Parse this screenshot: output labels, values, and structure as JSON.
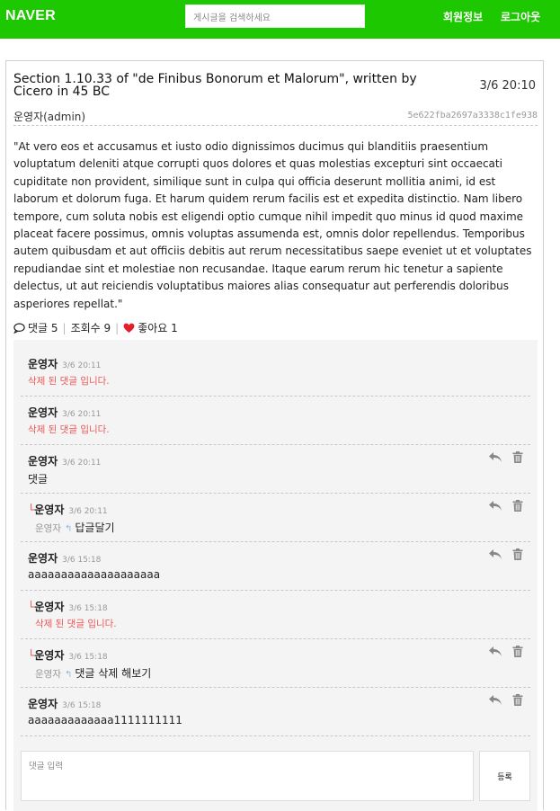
{
  "header": {
    "brand": "NAVER",
    "search_placeholder": "게시글을 검색하세요",
    "nav_info": "회원정보",
    "nav_logout": "로그아웃",
    "colors": {
      "brand_green": "#1ec800",
      "deleted_red": "#ee5555",
      "heart": "#e0202b"
    }
  },
  "post": {
    "title": "Section 1.10.33 of \"de Finibus Bonorum et Malorum\", written by Cicero in 45 BC",
    "date": "3/6 20:10",
    "author": "운영자(admin)",
    "id": "5e622fba2697a3338c1fe938",
    "body": "\"At vero eos et accusamus et iusto odio dignissimos ducimus qui blanditiis praesentium voluptatum deleniti atque corrupti quos dolores et quas molestias excepturi sint occaecati cupiditate non provident, similique sunt in culpa qui officia deserunt mollitia animi, id est laborum et dolorum fuga. Et harum quidem rerum facilis est et expedita distinctio. Nam libero tempore, cum soluta nobis est eligendi optio cumque nihil impedit quo minus id quod maxime placeat facere possimus, omnis voluptas assumenda est, omnis dolor repellendus. Temporibus autem quibusdam et aut officiis debitis aut rerum necessitatibus saepe eveniet ut et voluptates repudiandae sint et molestiae non recusandae. Itaque earum rerum hic tenetur a sapiente delectus, ut aut reiciendis voluptatibus maiores alias consequatur aut perferendis doloribus asperiores repellat.\"",
    "stats": {
      "comments": "댓글 5",
      "views": "조회수 9",
      "likes": "좋아요 1"
    }
  },
  "comments": [
    {
      "name": "운영자",
      "time": "3/6 20:11",
      "text": "삭제 된 댓글 입니다."
    },
    {
      "name": "운영자",
      "time": "3/6 20:11",
      "text": "삭제 된 댓글 입니다."
    },
    {
      "name": "운영자",
      "time": "3/6 20:11",
      "text": "댓글"
    },
    {
      "name": "운영자",
      "time": "3/6 20:11",
      "mention": "운영자",
      "text": "답글달기"
    },
    {
      "name": "운영자",
      "time": "3/6 15:18",
      "text": "aaaaaaaaaaaaaaaaaaaa"
    },
    {
      "name": "운영자",
      "time": "3/6 15:18",
      "text": "삭제 된 댓글 입니다."
    },
    {
      "name": "운영자",
      "time": "3/6 15:18",
      "mention": "운영자",
      "text": "댓글 삭제 해보기"
    },
    {
      "name": "운영자",
      "time": "3/6 15:18",
      "text": "aaaaaaaaaaaaa1111111111"
    }
  ],
  "comment_form": {
    "placeholder": "댓글 입력",
    "submit_label": "등록"
  }
}
